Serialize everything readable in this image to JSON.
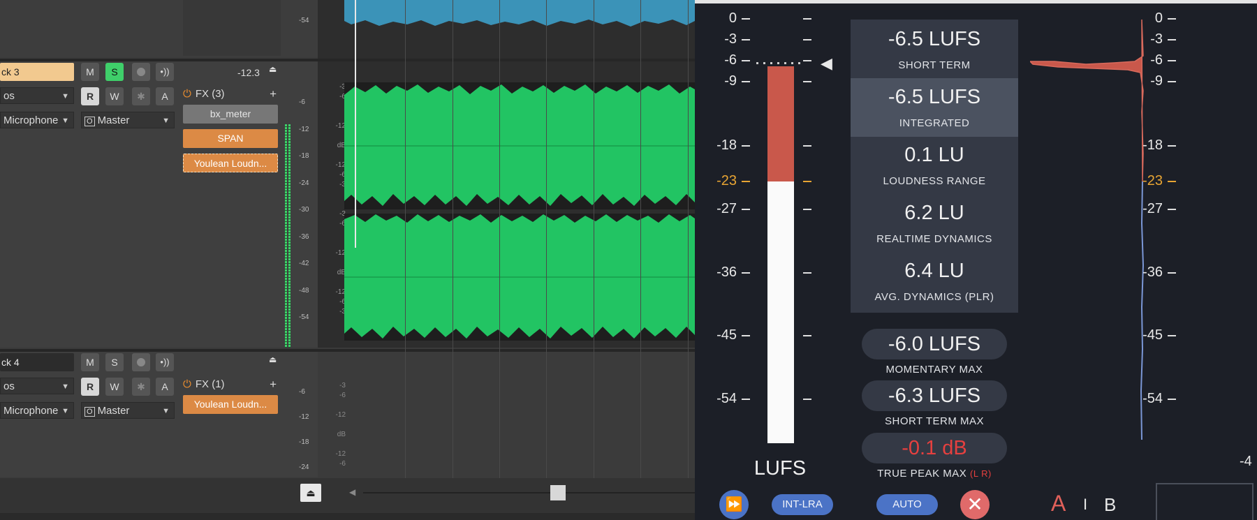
{
  "tracks": [
    {
      "name": "ck 3",
      "volume": "-12.3",
      "buttons": {
        "mute": "M",
        "solo": "S",
        "read": "R",
        "write": "W",
        "auto": "A"
      },
      "input_dropdown": "os",
      "mic_dropdown": "Microphone",
      "route_dropdown": "Master",
      "fx_header": "FX (3)",
      "fx": [
        "bx_meter",
        "SPAN",
        "Youlean Loudn..."
      ],
      "meter_scale": [
        "-6",
        "-12",
        "-18",
        "-24",
        "-30",
        "-36",
        "-42",
        "-48",
        "-54"
      ]
    },
    {
      "name": "ck 4",
      "buttons": {
        "mute": "M",
        "solo": "S",
        "read": "R",
        "write": "W",
        "auto": "A"
      },
      "input_dropdown": "os",
      "mic_dropdown": "Microphone",
      "route_dropdown": "Master",
      "fx_header": "FX (1)",
      "fx": [
        "Youlean Loudn..."
      ],
      "meter_scale": [
        "-6",
        "-12",
        "-18",
        "-24"
      ]
    }
  ],
  "top_meter_label": "-54",
  "plugin": {
    "left_scale": [
      {
        "label": "0"
      },
      {
        "label": "-3"
      },
      {
        "label": "-6"
      },
      {
        "label": "-9"
      },
      {
        "label": "-18"
      },
      {
        "label": "-23",
        "highlight": true
      },
      {
        "label": "-27"
      },
      {
        "label": "-36"
      },
      {
        "label": "-45"
      },
      {
        "label": "-54"
      }
    ],
    "right_scale": [
      {
        "label": "0"
      },
      {
        "label": "-3"
      },
      {
        "label": "-6"
      },
      {
        "label": "-9"
      },
      {
        "label": "-18"
      },
      {
        "label": "-23",
        "highlight": true
      },
      {
        "label": "-27"
      },
      {
        "label": "-36"
      },
      {
        "label": "-45"
      },
      {
        "label": "-54"
      }
    ],
    "meter_unit": "LUFS",
    "meter_level_lufs": -6.5,
    "meter_target_lufs": -23,
    "stats": [
      {
        "value": "-6.5 LUFS",
        "label": "SHORT TERM"
      },
      {
        "value": "-6.5 LUFS",
        "label": "INTEGRATED"
      },
      {
        "value": "0.1 LU",
        "label": "LOUDNESS RANGE"
      },
      {
        "value": "6.2 LU",
        "label": "REALTIME DYNAMICS"
      },
      {
        "value": "6.4 LU",
        "label": "AVG. DYNAMICS (PLR)"
      }
    ],
    "pills": [
      {
        "value": "-6.0 LUFS",
        "label": "MOMENTARY MAX"
      },
      {
        "value": "-6.3 LUFS",
        "label": "SHORT TERM MAX"
      },
      {
        "value": "-0.1 dB",
        "label": "TRUE PEAK MAX",
        "suffix": "(L R)"
      }
    ],
    "buttons": {
      "int_lra": "INT-LRA",
      "auto": "AUTO"
    },
    "ab": {
      "a": "A",
      "sep": "I",
      "b": "B"
    },
    "right_edge_label": "-4",
    "colors": {
      "accent_blue": "#4b73c6",
      "meter_red": "#c9584b",
      "target_orange": "#e8a533",
      "peak_red": "#e6403f"
    }
  }
}
